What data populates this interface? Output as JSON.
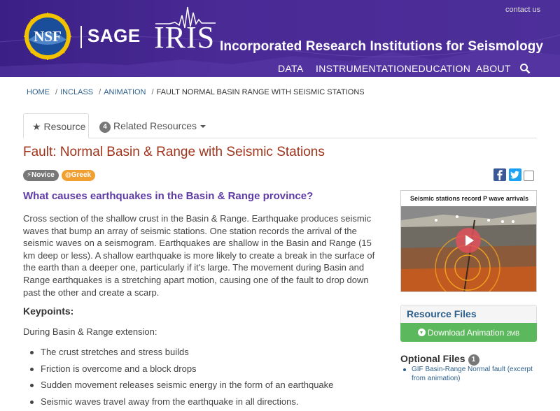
{
  "header": {
    "contact": "contact us",
    "nsf_text": "NSF",
    "sage": "SAGE",
    "iris": "IRIS",
    "iris_full": "Incorporated Research Institutions for Seismology",
    "nav": [
      "DATA",
      "INSTRUMENTATION",
      "EDUCATION",
      "ABOUT"
    ]
  },
  "breadcrumb": {
    "items": [
      "HOME",
      "INCLASS",
      "ANIMATION"
    ],
    "current": "FAULT NORMAL BASIN RANGE WITH SEISMIC STATIONS"
  },
  "tabs": {
    "resource": "Resource",
    "related_count": "4",
    "related": "Related Resources"
  },
  "title": "Fault: Normal Basin & Range with Seismic Stations",
  "badges": {
    "novice": "Novice",
    "greek": "Greek"
  },
  "question": "What causes earthquakes in the Basin & Range province?",
  "description": "Cross section of the shallow crust in the Basin & Range. Earthquake produces seismic waves that bump an array of seismic stations. One station records the arrival of the seismic waves on a seismogram. Earthquakes are shallow in the Basin and Range (15 km deep or less). A shallow earthquake is more likely to create a break in the surface of the earth than a deeper one, particularly if it's large. The movement during Basin and Range earthquakes is a stretching apart motion, causing one of the fault to drop down past the other and create a scarp.",
  "keypoints_label": "Keypoints:",
  "during": "During Basin & Range extension:",
  "keypoints": [
    "The crust stretches and stress builds",
    "Friction is overcome and a block drops",
    "Sudden movement releases seismic energy in the form of an earthquake",
    "Seismic waves travel away from the earthquake in all directions."
  ],
  "video": {
    "title": "Seismic stations record P wave arrivals"
  },
  "resource_files": {
    "heading": "Resource Files",
    "download_label": "Download Animation",
    "download_size": "2MB"
  },
  "optional_files": {
    "heading": "Optional Files",
    "count": "1",
    "items": [
      "GIF Basin-Range Normal fault (excerpt from animation)"
    ]
  },
  "colors": {
    "header_bg": "#4a2a95",
    "title": "#a0341b",
    "question": "#5e3aa4",
    "link": "#2d5f8b",
    "success": "#5cb85c"
  }
}
